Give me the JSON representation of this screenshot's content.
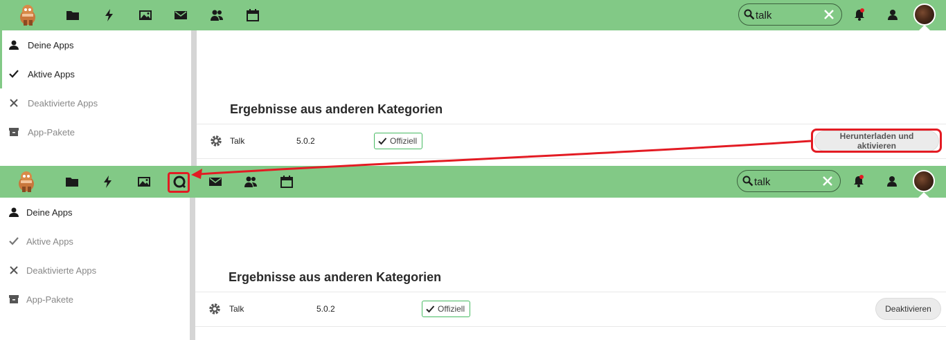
{
  "colors": {
    "accent": "#82c986",
    "annotation": "#e31b23",
    "official": "#46ba61"
  },
  "top": {
    "nav_icons": [
      "files-icon",
      "activity-icon",
      "gallery-icon",
      "mail-icon",
      "contacts-icon",
      "calendar-icon"
    ],
    "search": {
      "value": "talk"
    },
    "sidebar": {
      "items": [
        {
          "label": "Deine Apps",
          "icon": "user-icon"
        },
        {
          "label": "Aktive Apps",
          "icon": "check-icon"
        },
        {
          "label": "Deaktivierte Apps",
          "icon": "close-icon"
        },
        {
          "label": "App-Pakete",
          "icon": "archive-icon"
        }
      ]
    },
    "section_title": "Ergebnisse aus anderen Kategorien",
    "app": {
      "name": "Talk",
      "version": "5.0.2",
      "badge": "Offiziell",
      "button": "Herunterladen und aktivieren"
    }
  },
  "bottom": {
    "nav_icons": [
      "files-icon",
      "activity-icon",
      "gallery-icon",
      "talk-icon",
      "mail-icon",
      "contacts-icon",
      "calendar-icon"
    ],
    "search": {
      "value": "talk"
    },
    "sidebar": {
      "items": [
        {
          "label": "Deine Apps",
          "icon": "user-icon"
        },
        {
          "label": "Aktive Apps",
          "icon": "check-icon"
        },
        {
          "label": "Deaktivierte Apps",
          "icon": "close-icon"
        },
        {
          "label": "App-Pakete",
          "icon": "archive-icon"
        }
      ]
    },
    "section_title": "Ergebnisse aus anderen Kategorien",
    "app": {
      "name": "Talk",
      "version": "5.0.2",
      "badge": "Offiziell",
      "button": "Deaktivieren"
    }
  }
}
